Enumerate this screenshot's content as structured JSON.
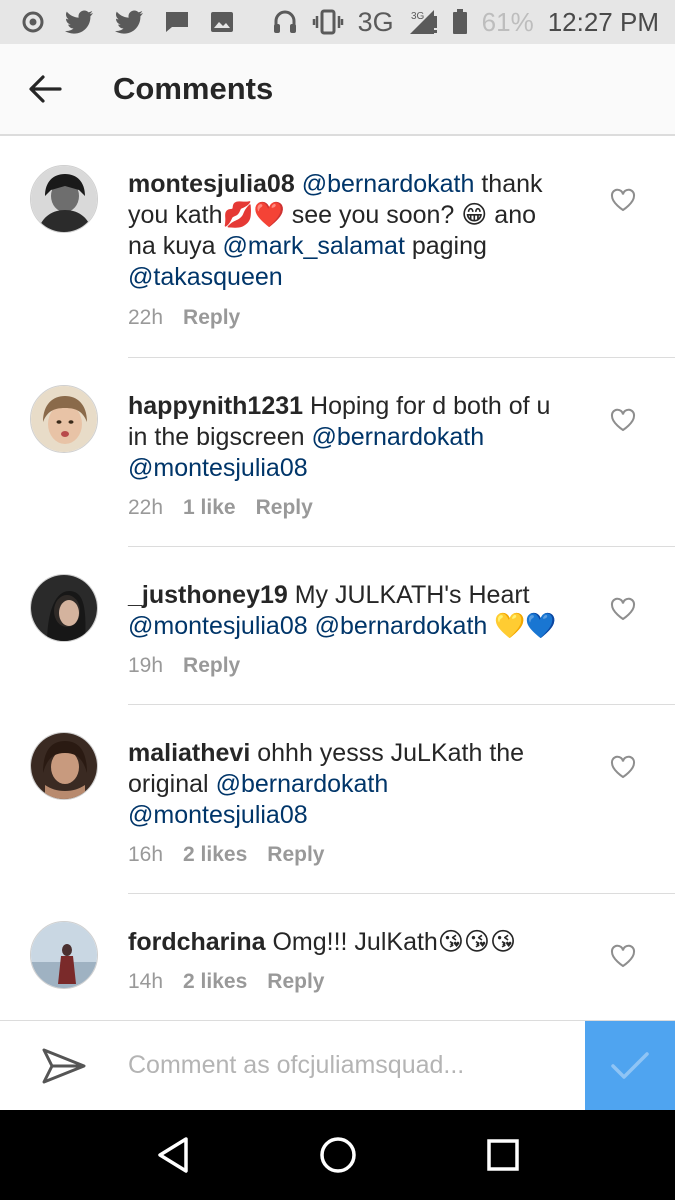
{
  "status_bar": {
    "network": "3G",
    "network_super": "3G",
    "battery": "61%",
    "time": "12:27 PM",
    "icons": [
      "circle-dot-icon",
      "twitter-icon",
      "twitter-icon",
      "message-icon",
      "image-icon",
      "headphones-icon",
      "vibrate-icon",
      "signal-icon",
      "battery-icon"
    ]
  },
  "header": {
    "title": "Comments",
    "back_icon": "arrow-left-icon"
  },
  "comments": [
    {
      "username": "montesjulia08",
      "parts": [
        {
          "type": "mention",
          "text": "@bernardokath"
        },
        {
          "type": "text",
          "text": " thank you kath💋❤️ see you soon? 😁 ano na kuya "
        },
        {
          "type": "mention",
          "text": "@mark_salamat"
        },
        {
          "type": "text",
          "text": "  paging "
        },
        {
          "type": "mention",
          "text": "@takasqueen"
        }
      ],
      "time": "22h",
      "likes": "",
      "reply": "Reply"
    },
    {
      "username": "happynith1231",
      "parts": [
        {
          "type": "text",
          "text": " Hoping for d both of u in the bigscreen "
        },
        {
          "type": "mention",
          "text": "@bernardokath"
        },
        {
          "type": "text",
          "text": " "
        },
        {
          "type": "mention",
          "text": "@montesjulia08"
        }
      ],
      "time": "22h",
      "likes": "1 like",
      "reply": "Reply"
    },
    {
      "username": "_justhoney19",
      "parts": [
        {
          "type": "text",
          "text": " My JULKATH's Heart "
        },
        {
          "type": "mention",
          "text": "@montesjulia08"
        },
        {
          "type": "text",
          "text": " "
        },
        {
          "type": "mention",
          "text": "@bernardokath"
        },
        {
          "type": "text",
          "text": " 💛💙"
        }
      ],
      "time": "19h",
      "likes": "",
      "reply": "Reply"
    },
    {
      "username": "maliathevi",
      "parts": [
        {
          "type": "text",
          "text": " ohhh yesss JuLKath the original "
        },
        {
          "type": "mention",
          "text": "@bernardokath"
        },
        {
          "type": "text",
          "text": " "
        },
        {
          "type": "mention",
          "text": "@montesjulia08"
        }
      ],
      "time": "16h",
      "likes": "2 likes",
      "reply": "Reply"
    },
    {
      "username": "fordcharina",
      "parts": [
        {
          "type": "text",
          "text": " Omg!!! JulKath😘😘😘"
        }
      ],
      "time": "14h",
      "likes": "2 likes",
      "reply": "Reply"
    }
  ],
  "composer": {
    "placeholder": "Comment as ofcjuliamsquad...",
    "send_icon": "paper-plane-icon",
    "post_icon": "checkmark-icon"
  },
  "navbar": {
    "icons": [
      "back-triangle-icon",
      "home-circle-icon",
      "recents-square-icon"
    ]
  },
  "colors": {
    "mention": "#003569",
    "post_button": "#4fa4f0",
    "meta": "#999999"
  }
}
